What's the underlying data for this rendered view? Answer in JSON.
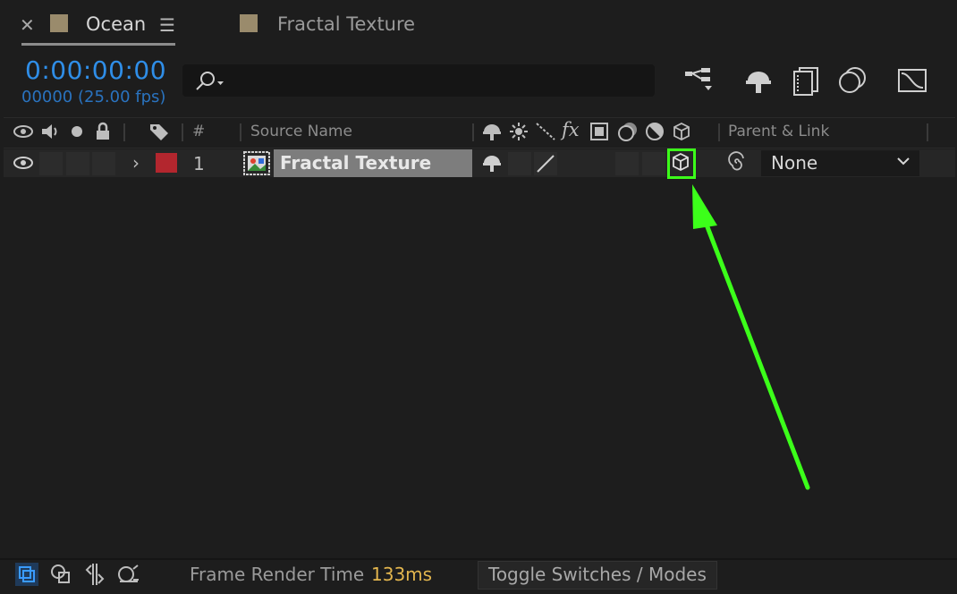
{
  "tabs": [
    {
      "label": "Ocean",
      "swatch_color": "#9a8b6c",
      "active": true
    },
    {
      "label": "Fractal Texture",
      "swatch_color": "#9a8b6c",
      "active": false
    }
  ],
  "timecode": {
    "time": "0:00:00:00",
    "frames": "00000 (25.00 fps)"
  },
  "search": {
    "placeholder": ""
  },
  "columns": {
    "number": "#",
    "source_name": "Source Name",
    "parent_link": "Parent & Link",
    "fx": "fx"
  },
  "layer": {
    "number": "1",
    "name": "Fractal Texture",
    "label_color": "#b3262e",
    "parent": "None"
  },
  "bottom": {
    "frame_render_time_label": "Frame Render Time",
    "frame_render_time_value": "133ms",
    "toggle_label": "Toggle Switches / Modes"
  },
  "colors": {
    "accent_blue": "#2f8ee8",
    "highlight_green": "#3cff1a",
    "render_time": "#e3b64e"
  }
}
